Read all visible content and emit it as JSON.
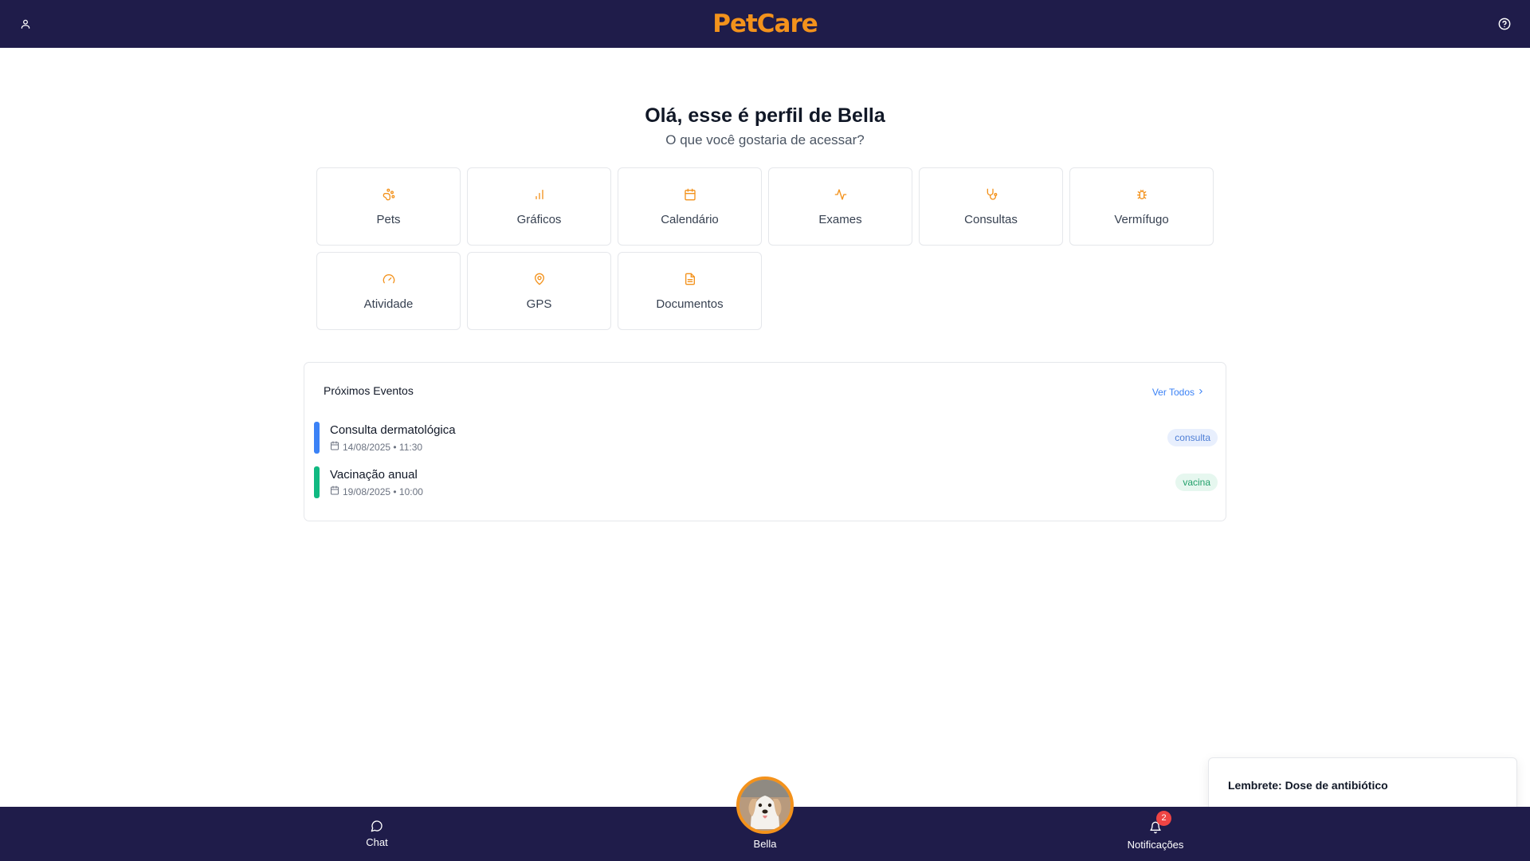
{
  "header": {
    "logo_text": "PetCare",
    "logo_color": "#f3921c",
    "background": "#1f1c4a",
    "left_icon": "user-icon",
    "right_icon": "help-circle-icon"
  },
  "greeting": {
    "title": "Olá, esse é perfil de Bella",
    "subtitle": "O que você gostaria de acessar?"
  },
  "menu": {
    "items": [
      {
        "label": "Pets",
        "icon": "paw-icon"
      },
      {
        "label": "Gráficos",
        "icon": "bar-chart-icon"
      },
      {
        "label": "Calendário",
        "icon": "calendar-icon"
      },
      {
        "label": "Exames",
        "icon": "activity-icon"
      },
      {
        "label": "Consultas",
        "icon": "stethoscope-icon"
      },
      {
        "label": "Vermífugo",
        "icon": "bug-icon"
      },
      {
        "label": "Atividade",
        "icon": "gauge-icon"
      },
      {
        "label": "GPS",
        "icon": "map-pin-icon"
      },
      {
        "label": "Documentos",
        "icon": "file-text-icon"
      }
    ]
  },
  "events": {
    "title": "Próximos Eventos",
    "view_all": "Ver Todos",
    "items": [
      {
        "title": "Consulta dermatológica",
        "date": "14/08/2025 • 11:30",
        "tag": "consulta",
        "bar_color": "#3b82f6",
        "tag_bg": "#e8effd",
        "tag_color": "#4f7fd6"
      },
      {
        "title": "Vacinação anual",
        "date": "19/08/2025 • 10:00",
        "tag": "vacina",
        "bar_color": "#10b981",
        "tag_bg": "#e6f7ef",
        "tag_color": "#22a06b"
      }
    ]
  },
  "toast": {
    "title": "Lembrete: Dose de antibiótico"
  },
  "bottom_nav": {
    "chat_label": "Chat",
    "pet_label": "Bella",
    "notifications_label": "Notificações",
    "notifications_count": "2"
  }
}
